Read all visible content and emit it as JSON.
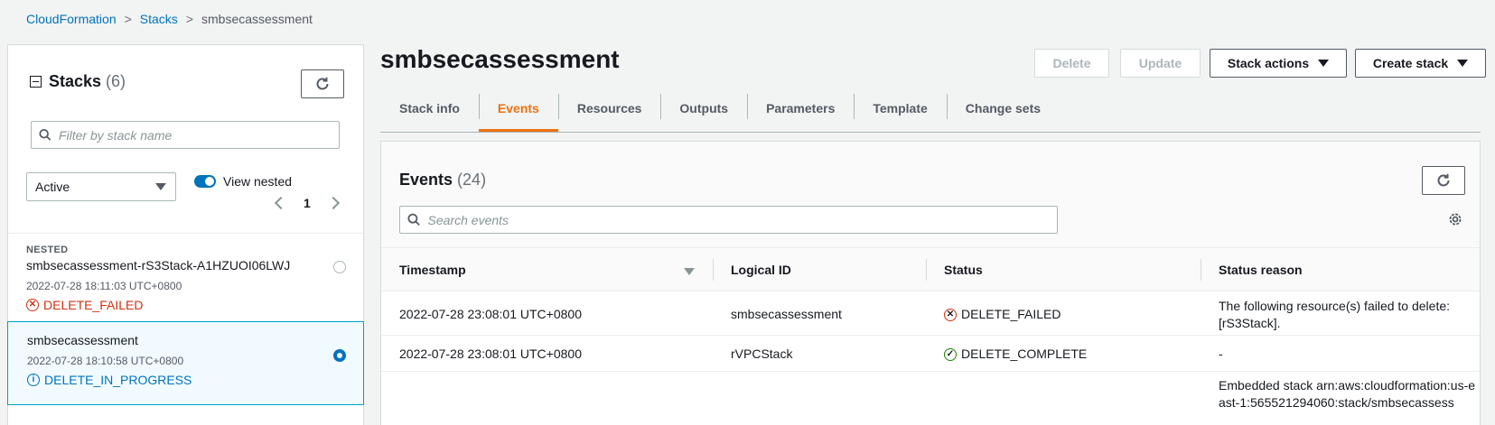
{
  "breadcrumb": {
    "items": [
      "CloudFormation",
      "Stacks"
    ],
    "current": "smbsecassessment"
  },
  "sidebar": {
    "title": "Stacks",
    "count": "(6)",
    "search_placeholder": "Filter by stack name",
    "filter_select": "Active",
    "toggle_label": "View nested",
    "toggle_on": true,
    "page": "1",
    "stacks": [
      {
        "tag": "NESTED",
        "name": "smbsecassessment-rS3Stack-A1HZUOI06LWJ",
        "time": "2022-07-28 18:11:03 UTC+0800",
        "status": "DELETE_FAILED",
        "selected": false
      },
      {
        "tag": "",
        "name": "smbsecassessment",
        "time": "2022-07-28 18:10:58 UTC+0800",
        "status": "DELETE_IN_PROGRESS",
        "selected": true
      }
    ]
  },
  "main": {
    "title": "smbsecassessment",
    "buttons": {
      "delete": "Delete",
      "update": "Update",
      "stack_actions": "Stack actions",
      "create_stack": "Create stack"
    },
    "tabs": [
      "Stack info",
      "Events",
      "Resources",
      "Outputs",
      "Parameters",
      "Template",
      "Change sets"
    ],
    "active_tab": "Events",
    "events": {
      "title": "Events",
      "count": "(24)",
      "search_placeholder": "Search events",
      "columns": [
        "Timestamp",
        "Logical ID",
        "Status",
        "Status reason"
      ],
      "rows": [
        {
          "timestamp": "2022-07-28 23:08:01 UTC+0800",
          "logical_id": "smbsecassessment",
          "status": "DELETE_FAILED",
          "reason": "The following resource(s) failed to delete: [rS3Stack]."
        },
        {
          "timestamp": "2022-07-28 23:08:01 UTC+0800",
          "logical_id": "rVPCStack",
          "status": "DELETE_COMPLETE",
          "reason": "-"
        },
        {
          "timestamp": "",
          "logical_id": "",
          "status": "",
          "reason": "Embedded stack arn:aws:cloudformation:us-east-1:565521294060:stack/smbsecassess"
        }
      ]
    }
  },
  "colors": {
    "link": "#0073bb",
    "accent": "#ec7211",
    "failed": "#d13212",
    "complete": "#1d8102"
  }
}
